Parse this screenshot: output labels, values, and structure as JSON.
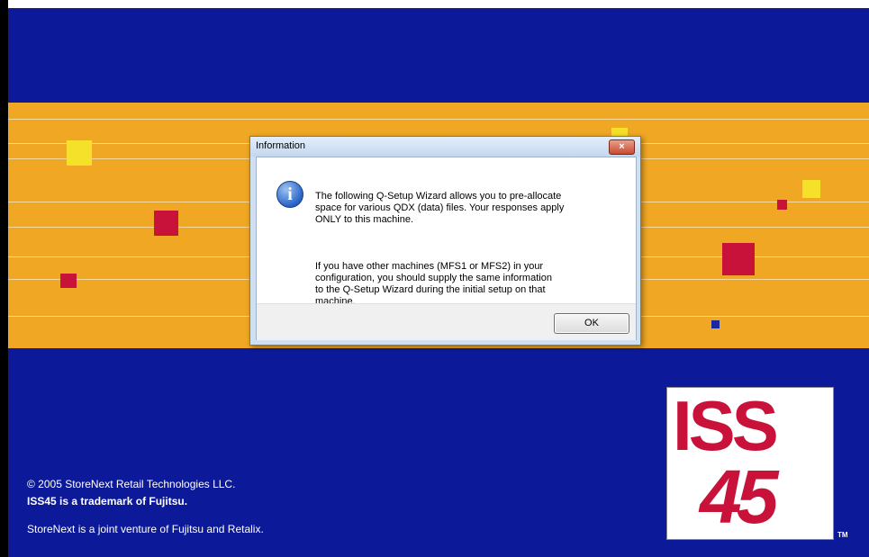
{
  "background": {
    "copyright_line1": "© 2005 StoreNext Retail Technologies LLC.",
    "copyright_line2": "ISS45 is a trademark of Fujitsu.",
    "copyright_line3": "StoreNext is a joint venture of Fujitsu and Retalix.",
    "logo_line1": "ISS",
    "logo_line2": "45",
    "trademark": "TM",
    "colors": {
      "blue": "#0c1a9a",
      "orange": "#f0a824",
      "red": "#c8123a",
      "yellow": "#f5e12a"
    }
  },
  "dialog": {
    "title": "Information",
    "close_label": "×",
    "icon": "information-icon",
    "message_p1": "The following Q-Setup Wizard allows you to pre-allocate\nspace for various QDX (data) files.  Your responses apply\nONLY to this machine.",
    "message_p2": "If you have other machines (MFS1 or MFS2) in your\nconfiguration, you should supply the same information\nto the Q-Setup Wizard during the initial setup on that\nmachine.",
    "ok_label": "OK"
  }
}
